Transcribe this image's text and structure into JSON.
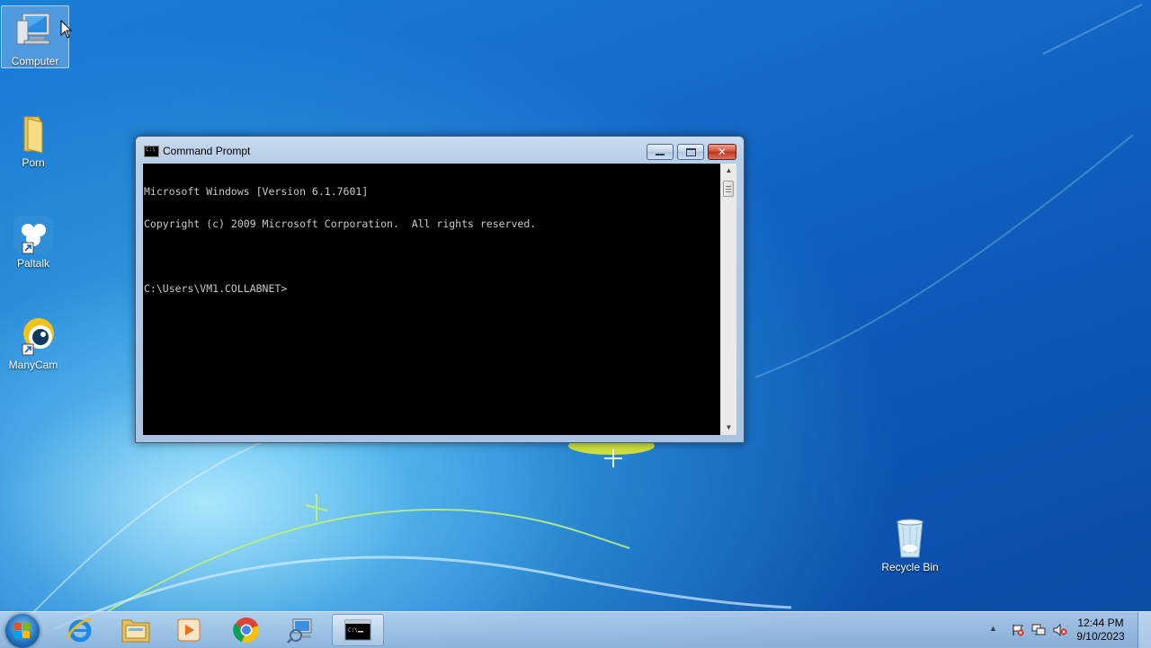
{
  "desktop": {
    "icons": [
      {
        "label": "Computer",
        "icon": "computer-icon"
      },
      {
        "label": "Porn",
        "icon": "folder-icon"
      },
      {
        "label": "Paltalk",
        "icon": "paltalk-icon"
      },
      {
        "label": "ManyCam",
        "icon": "manycam-icon"
      },
      {
        "label": "Recycle Bin",
        "icon": "recycle-bin-icon"
      }
    ]
  },
  "window": {
    "title": "Command Prompt",
    "console_lines": [
      "Microsoft Windows [Version 6.1.7601]",
      "Copyright (c) 2009 Microsoft Corporation.  All rights reserved.",
      "",
      "C:\\Users\\VM1.COLLABNET>"
    ],
    "close_glyph": "✕"
  },
  "taskbar": {
    "pinned": [
      "start-orb-icon",
      "internet-explorer-icon",
      "windows-explorer-icon",
      "media-player-icon",
      "chrome-icon",
      "network-tool-icon",
      "command-prompt-icon"
    ],
    "clock": {
      "time": "12:44 PM",
      "date": "9/10/2023"
    },
    "tray_arrow": "▲"
  },
  "colors": {
    "console_bg": "#000000",
    "console_fg": "#c8c8c8",
    "close_red": "#c0321a"
  }
}
